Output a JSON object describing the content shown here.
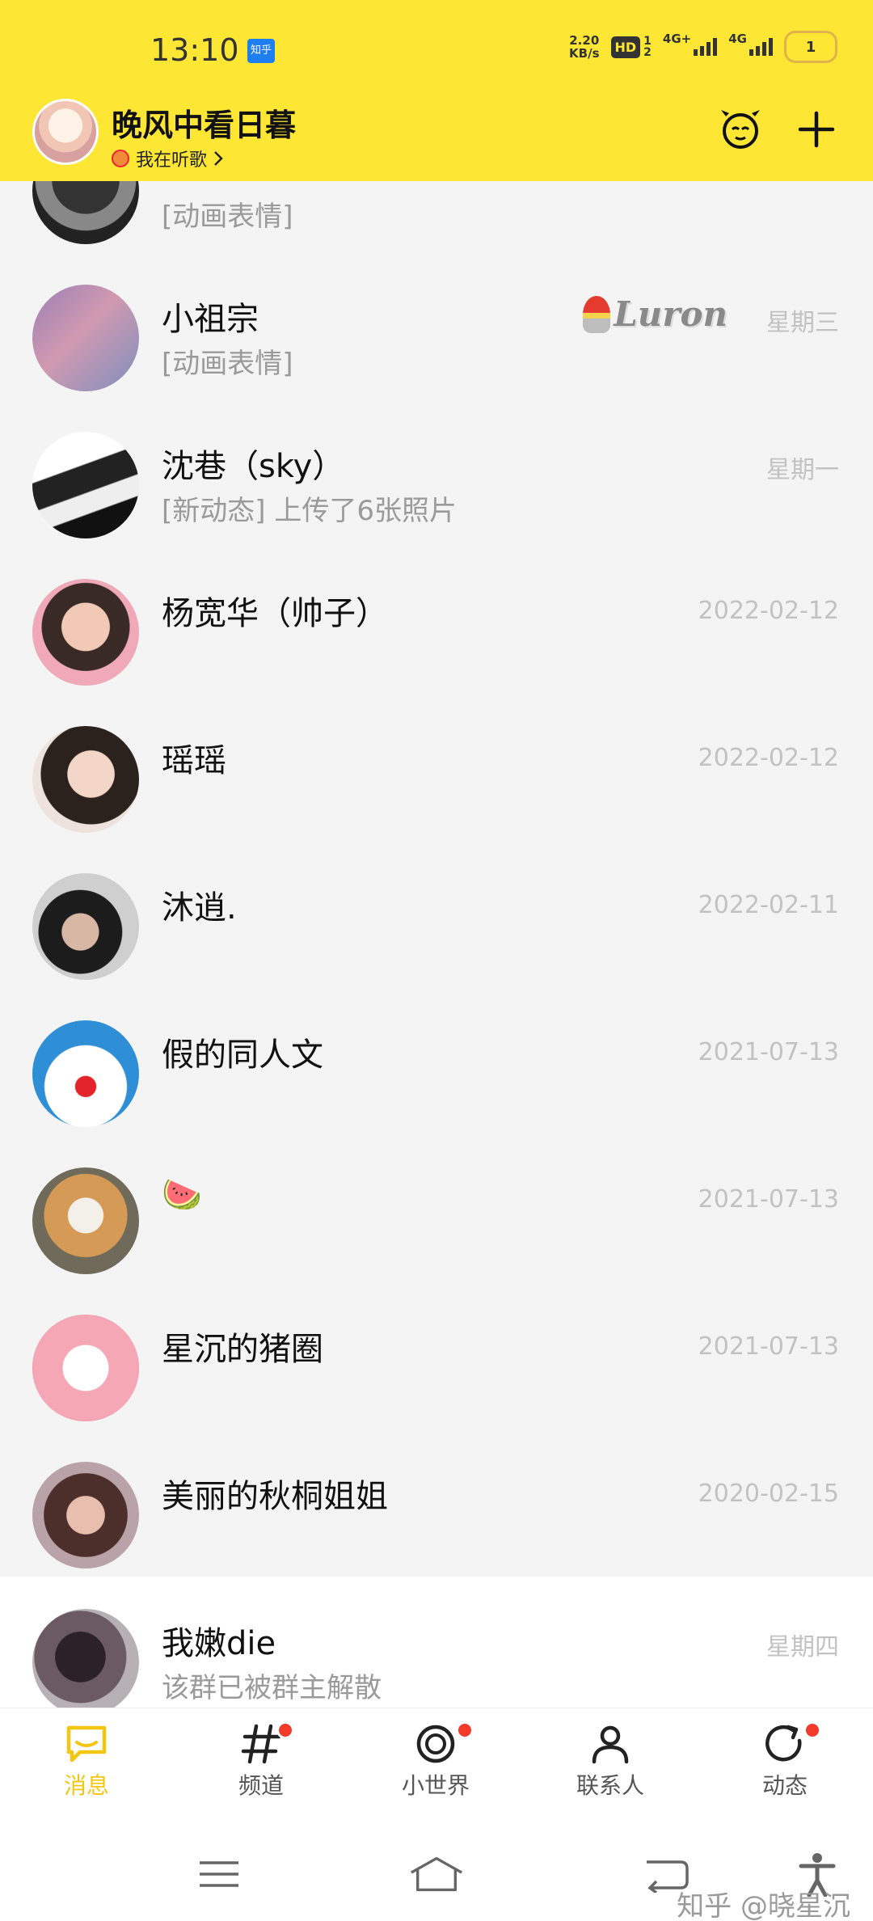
{
  "status_bar": {
    "time": "13:10",
    "app_icon_text": "知乎",
    "net_speed_value": "2.20",
    "net_speed_unit": "KB/s",
    "hd_label": "HD",
    "hd_sub_top": "1",
    "hd_sub_bottom": "2",
    "signal1_label": "4G+",
    "signal2_label": "4G",
    "battery_level": "1"
  },
  "header": {
    "username": "晚风中看日暮",
    "status_text": "我在听歌"
  },
  "conversations": [
    {
      "name": "",
      "preview": "[动画表情]",
      "time": ""
    },
    {
      "name": "小祖宗",
      "preview": "[动画表情]",
      "time": "星期三",
      "decoration_text": "Luron"
    },
    {
      "name": "沈巷（sky）",
      "preview": "[新动态] 上传了6张照片",
      "time": "星期一"
    },
    {
      "name": "杨宽华（帅子）",
      "preview": "",
      "time": "2022-02-12"
    },
    {
      "name": "瑶瑶",
      "preview": "",
      "time": "2022-02-12"
    },
    {
      "name": "沐逍.",
      "preview": "",
      "time": "2022-02-11"
    },
    {
      "name": "假的同人文",
      "preview": "",
      "time": "2021-07-13"
    },
    {
      "name": "🍉",
      "preview": "",
      "time": "2021-07-13"
    },
    {
      "name": "星沉的猪圈",
      "preview": "",
      "time": "2021-07-13"
    },
    {
      "name": "美丽的秋桐姐姐",
      "preview": "",
      "time": "2020-02-15"
    },
    {
      "name": "我嫩die",
      "preview": "该群已被群主解散",
      "time": "星期四"
    }
  ],
  "tabs": [
    {
      "label": "消息",
      "active": true
    },
    {
      "label": "频道",
      "badge": true
    },
    {
      "label": "小世界",
      "badge": true
    },
    {
      "label": "联系人"
    },
    {
      "label": "动态",
      "badge": true
    }
  ],
  "watermark": "知乎 @晓星沉",
  "colors": {
    "accent": "#fee635",
    "active_tab": "#f3c612",
    "badge": "#f23a2a",
    "list_bg": "#f4f4f4"
  }
}
